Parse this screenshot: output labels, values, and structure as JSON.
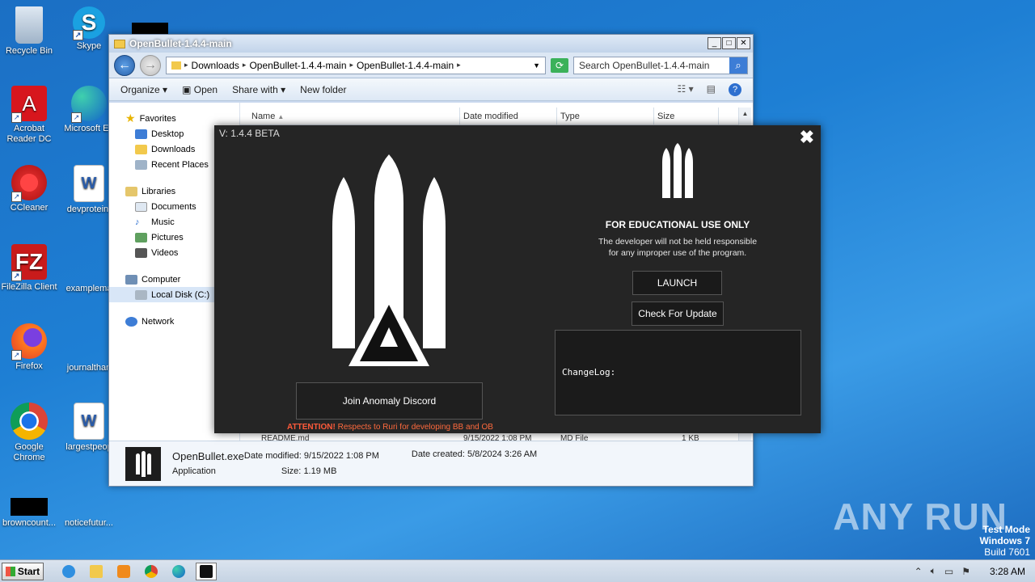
{
  "desktop": {
    "icons": [
      {
        "label": "Recycle Bin"
      },
      {
        "label": "Skype"
      },
      {
        "label": "Acrobat Reader DC"
      },
      {
        "label": "Microsoft Ed"
      },
      {
        "label": "CCleaner"
      },
      {
        "label": "devprotein."
      },
      {
        "label": "FileZilla Client"
      },
      {
        "label": "examplema"
      },
      {
        "label": "Firefox"
      },
      {
        "label": "journalthan"
      },
      {
        "label": "Google Chrome"
      },
      {
        "label": "largestpeop"
      },
      {
        "label": "browncount..."
      },
      {
        "label": "noticefutur..."
      }
    ],
    "watermark": "ANY RUN",
    "test_mode": {
      "line1": "Test Mode",
      "line2": "Windows 7",
      "line3": "Build 7601"
    }
  },
  "explorer": {
    "title": "OpenBullet-1.4.4-main",
    "breadcrumb": [
      "Downloads",
      "OpenBullet-1.4.4-main",
      "OpenBullet-1.4.4-main"
    ],
    "search_placeholder": "Search OpenBullet-1.4.4-main",
    "toolbar": {
      "organize": "Organize",
      "open": "Open",
      "share": "Share with",
      "new_folder": "New folder"
    },
    "nav": {
      "favorites": "Favorites",
      "desktop": "Desktop",
      "downloads": "Downloads",
      "recent": "Recent Places",
      "libraries": "Libraries",
      "documents": "Documents",
      "music": "Music",
      "pictures": "Pictures",
      "videos": "Videos",
      "computer": "Computer",
      "local_disk": "Local Disk (C:)",
      "network": "Network"
    },
    "columns": {
      "name": "Name",
      "date": "Date modified",
      "type": "Type",
      "size": "Size"
    },
    "partial_row": {
      "name": "README.md",
      "date": "9/15/2022 1:08 PM",
      "type": "MD File",
      "size": "1 KB"
    },
    "details": {
      "file_name": "OpenBullet.exe",
      "file_type": "Application",
      "date_modified_label": "Date modified:",
      "date_modified": "9/15/2022 1:08 PM",
      "size_label": "Size:",
      "size": "1.19 MB",
      "date_created_label": "Date created:",
      "date_created": "5/8/2024 3:26 AM"
    }
  },
  "launcher": {
    "version": "V: 1.4.4 BETA",
    "edu_title": "FOR EDUCATIONAL USE ONLY",
    "edu_line1": "The developer will not be held responsible",
    "edu_line2": "for any improper use of the program.",
    "launch": "LAUNCH",
    "update": "Check For Update",
    "changelog": "ChangeLog:",
    "discord": "Join Anomaly Discord",
    "attention_label": "ATTENTION!",
    "attention_text": "Respects to Ruri for developing BB and OB",
    "logo_letter": "A"
  },
  "taskbar": {
    "start": "Start",
    "clock": "3:28 AM"
  }
}
